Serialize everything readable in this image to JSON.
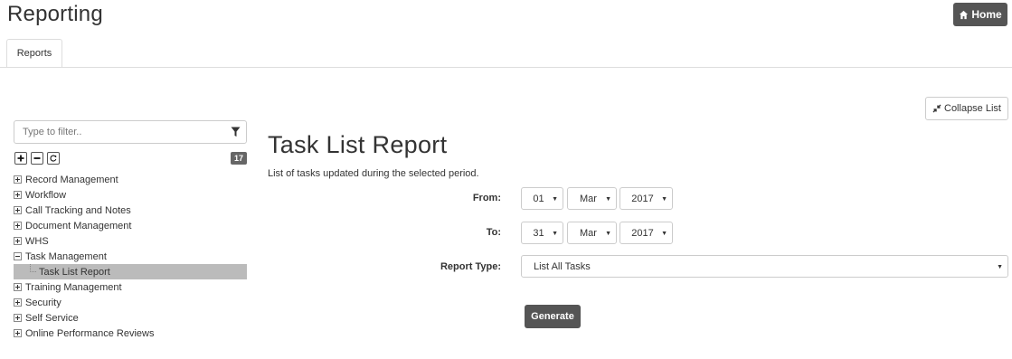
{
  "header": {
    "title": "Reporting",
    "home_label": "Home"
  },
  "tabs": [
    {
      "label": "Reports",
      "active": true
    }
  ],
  "toolbar": {
    "collapse_label": "Collapse List"
  },
  "sidebar": {
    "filter_placeholder": "Type to filter..",
    "count": "17",
    "items": [
      {
        "label": "Record Management",
        "expanded": false
      },
      {
        "label": "Workflow",
        "expanded": false
      },
      {
        "label": "Call Tracking and Notes",
        "expanded": false
      },
      {
        "label": "Document Management",
        "expanded": false
      },
      {
        "label": "WHS",
        "expanded": false
      },
      {
        "label": "Task Management",
        "expanded": true
      },
      {
        "label": "Task List Report",
        "child": true,
        "selected": true
      },
      {
        "label": "Training Management",
        "expanded": false
      },
      {
        "label": "Security",
        "expanded": false
      },
      {
        "label": "Self Service",
        "expanded": false
      },
      {
        "label": "Online Performance Reviews",
        "expanded": false
      }
    ]
  },
  "report": {
    "title": "Task List Report",
    "description": "List of tasks updated during the selected period.",
    "from": {
      "label": "From:",
      "day": "01",
      "month": "Mar",
      "year": "2017"
    },
    "to": {
      "label": "To:",
      "day": "31",
      "month": "Mar",
      "year": "2017"
    },
    "report_type": {
      "label": "Report Type:",
      "value": "List All Tasks"
    },
    "generate_label": "Generate"
  },
  "colors": {
    "dark_button": "#555555",
    "selected_row": "#bbbbbb",
    "border": "#cccccc"
  }
}
